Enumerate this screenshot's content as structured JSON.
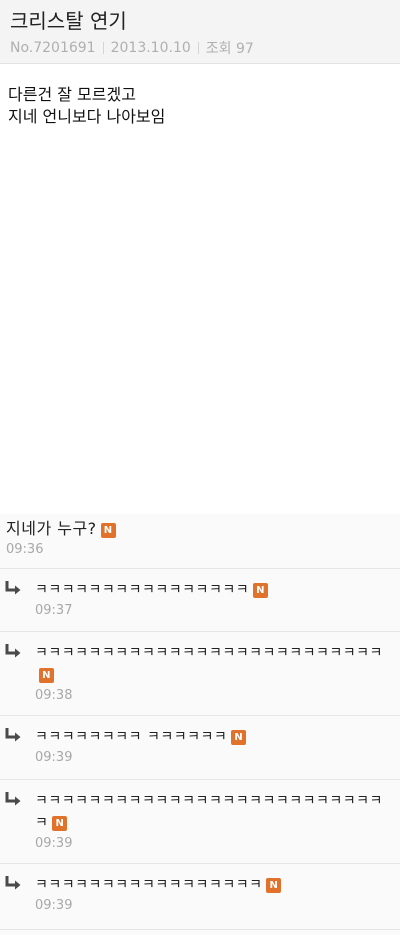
{
  "post": {
    "title": "크리스탈 연기",
    "number": "No.7201691",
    "date": "2013.10.10",
    "views": "조회 97",
    "body_lines": [
      "다른건 잘 모르겠고",
      "지네 언니보다 나아보임"
    ]
  },
  "new_badge": "N",
  "colors": {
    "badge": "#e0722b",
    "arrow": "#4a4a4a"
  },
  "comments": [
    {
      "text": "지네가 누구?",
      "time": "09:36",
      "is_reply": false
    },
    {
      "text": "ㅋㅋㅋㅋㅋㅋㅋㅋㅋㅋㅋㅋㅋㅋㅋㅋ",
      "time": "09:37",
      "is_reply": true
    },
    {
      "text": "ㅋㅋㅋㅋㅋㅋㅋㅋㅋㅋㅋㅋㅋㅋㅋㅋㅋㅋㅋㅋㅋㅋㅋㅋㅋㅋ",
      "time": "09:38",
      "is_reply": true
    },
    {
      "text": "ㅋㅋㅋㅋㅋㅋㅋㅋ ㅋㅋㅋㅋㅋㅋ",
      "time": "09:39",
      "is_reply": true
    },
    {
      "text": "ㅋㅋㅋㅋㅋㅋㅋㅋㅋㅋㅋㅋㅋㅋㅋㅋㅋㅋㅋㅋㅋㅋㅋㅋㅋㅋㅋ",
      "time": "09:39",
      "is_reply": true
    },
    {
      "text": "ㅋㅋㅋㅋㅋㅋㅋㅋㅋㅋㅋㅋㅋㅋㅋㅋㅋ",
      "time": "09:39",
      "is_reply": true
    }
  ]
}
